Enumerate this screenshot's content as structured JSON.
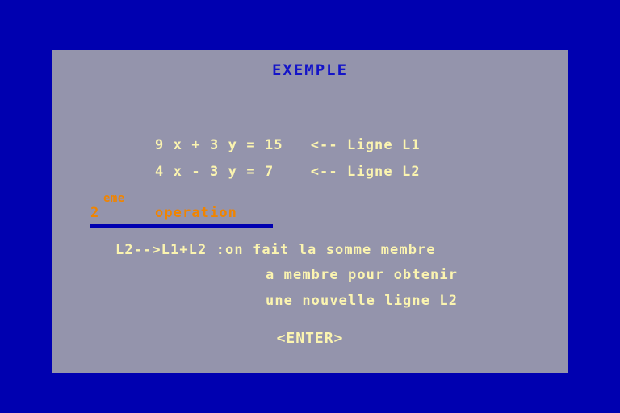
{
  "screen": {
    "background_color": "#0000b0",
    "panel_color": "#9494ac"
  },
  "panel": {
    "title": "EXEMPLE",
    "title_color": "#1414c8",
    "text_color": "#fbf4b0",
    "accent_color": "#f08400",
    "equations": [
      "9 x + 3 y = 15   <-- Ligne L1",
      "4 x - 3 y = 7    <-- Ligne L2"
    ],
    "operation_heading": {
      "number": "2",
      "superscript": "eme",
      "word": "operation",
      "underline_color": "#0000b0"
    },
    "description_lines": [
      "L2-->L1+L2 :on fait la somme membre",
      "a membre pour obtenir",
      "une nouvelle ligne L2"
    ],
    "prompt": "<ENTER>"
  }
}
